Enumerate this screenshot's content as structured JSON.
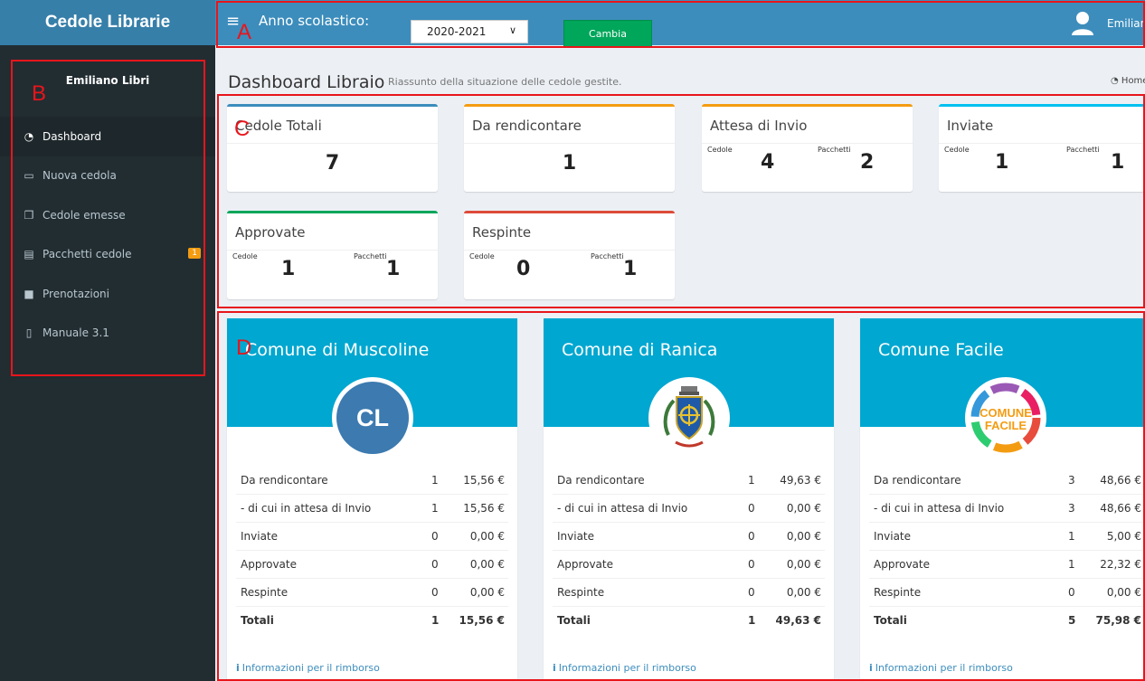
{
  "brand": "Cedole Librarie",
  "topbar": {
    "menu_glyph": "≡",
    "anno_label": "Anno scolastico:",
    "anno_value": "2020-2021",
    "cambia_label": "Cambia",
    "user_name": "Emiliano Libri"
  },
  "sidebar": {
    "user": "Emiliano Libri",
    "items": [
      {
        "label": "Dashboard",
        "icon": "dashboard-icon"
      },
      {
        "label": "Nuova cedola",
        "icon": "desktop-icon"
      },
      {
        "label": "Cedole emesse",
        "icon": "copy-icon"
      },
      {
        "label": "Pacchetti cedole",
        "icon": "list-icon",
        "badge": "1"
      },
      {
        "label": "Prenotazioni",
        "icon": "book-icon"
      },
      {
        "label": "Manuale 3.1",
        "icon": "open-book-icon"
      }
    ]
  },
  "header": {
    "title": "Dashboard Libraio",
    "subtitle": "Riassunto della situazione delle cedole gestite.",
    "breadcrumb": "Home"
  },
  "stats": {
    "labels": {
      "cedole": "Cedole",
      "pacchetti": "Pacchetti"
    },
    "totali": {
      "title": "Cedole Totali",
      "value": "7"
    },
    "da_rendicontare": {
      "title": "Da rendicontare",
      "value": "1"
    },
    "attesa": {
      "title": "Attesa di Invio",
      "cedole": "4",
      "pacchetti": "2"
    },
    "inviate": {
      "title": "Inviate",
      "cedole": "1",
      "pacchetti": "1"
    },
    "approvate": {
      "title": "Approvate",
      "cedole": "1",
      "pacchetti": "1"
    },
    "respinte": {
      "title": "Respinte",
      "cedole": "0",
      "pacchetti": "1"
    }
  },
  "colors": {
    "totali": "#3c8dbc",
    "da_rendicontare": "#f39c12",
    "attesa": "#f39c12",
    "inviate": "#00c0ef",
    "approvate": "#00a65a",
    "respinte": "#dd4b39"
  },
  "comuni": [
    {
      "name": "Comune di Muscoline",
      "logo_text": "CL",
      "rows": [
        {
          "label": "Da rendicontare",
          "count": "1",
          "amount": "15,56 €"
        },
        {
          "label": "- di cui in attesa di Invio",
          "count": "1",
          "amount": "15,56 €"
        },
        {
          "label": "Inviate",
          "count": "0",
          "amount": "0,00 €"
        },
        {
          "label": "Approvate",
          "count": "0",
          "amount": "0,00 €"
        },
        {
          "label": "Respinte",
          "count": "0",
          "amount": "0,00 €"
        },
        {
          "label": "Totali",
          "count": "1",
          "amount": "15,56 €"
        }
      ],
      "footer": "Informazioni per il rimborso"
    },
    {
      "name": "Comune di Ranica",
      "rows": [
        {
          "label": "Da rendicontare",
          "count": "1",
          "amount": "49,63 €"
        },
        {
          "label": "- di cui in attesa di Invio",
          "count": "0",
          "amount": "0,00 €"
        },
        {
          "label": "Inviate",
          "count": "0",
          "amount": "0,00 €"
        },
        {
          "label": "Approvate",
          "count": "0",
          "amount": "0,00 €"
        },
        {
          "label": "Respinte",
          "count": "0",
          "amount": "0,00 €"
        },
        {
          "label": "Totali",
          "count": "1",
          "amount": "49,63 €"
        }
      ],
      "footer": "Informazioni per il rimborso"
    },
    {
      "name": "Comune Facile",
      "logo_text_1": "COMUNE",
      "logo_text_2": "FACILE",
      "rows": [
        {
          "label": "Da rendicontare",
          "count": "3",
          "amount": "48,66 €"
        },
        {
          "label": "- di cui in attesa di Invio",
          "count": "3",
          "amount": "48,66 €"
        },
        {
          "label": "Inviate",
          "count": "1",
          "amount": "5,00 €"
        },
        {
          "label": "Approvate",
          "count": "1",
          "amount": "22,32 €"
        },
        {
          "label": "Respinte",
          "count": "0",
          "amount": "0,00 €"
        },
        {
          "label": "Totali",
          "count": "5",
          "amount": "75,98 €"
        }
      ],
      "footer": "Informazioni per il rimborso"
    }
  ],
  "annotations": {
    "a": "A",
    "b": "B",
    "c": "C",
    "d": "D"
  }
}
